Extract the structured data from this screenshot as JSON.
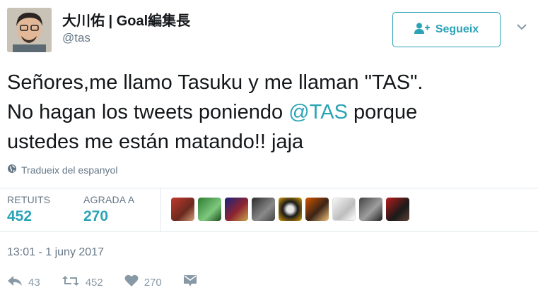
{
  "author": {
    "name": "大川佑 | Goal編集長",
    "handle": "@tas"
  },
  "follow_button": {
    "label": "Segueix"
  },
  "tweet": {
    "line1": "Señores,me llamo Tasuku y me llaman \"TAS\".",
    "line2_before": "No hagan los tweets poniendo ",
    "mention": "@TAS",
    "line2_after": " porque",
    "line3": "ustedes me están matando!! jaja"
  },
  "translate_label": "Tradueix del espanyol",
  "stats": {
    "retweets_label": "RETUITS",
    "retweets_value": "452",
    "likes_label": "AGRADA A",
    "likes_value": "270"
  },
  "timestamp": "13:01 - 1 juny 2017",
  "actions": {
    "reply_count": "43",
    "retweet_count": "452",
    "like_count": "270"
  },
  "colors": {
    "accent": "#2aa3b7",
    "muted": "#657786"
  },
  "icons": [
    "user-plus-icon",
    "chevron-down-icon",
    "globe-icon",
    "reply-icon",
    "retweet-icon",
    "heart-icon",
    "message-icon"
  ]
}
